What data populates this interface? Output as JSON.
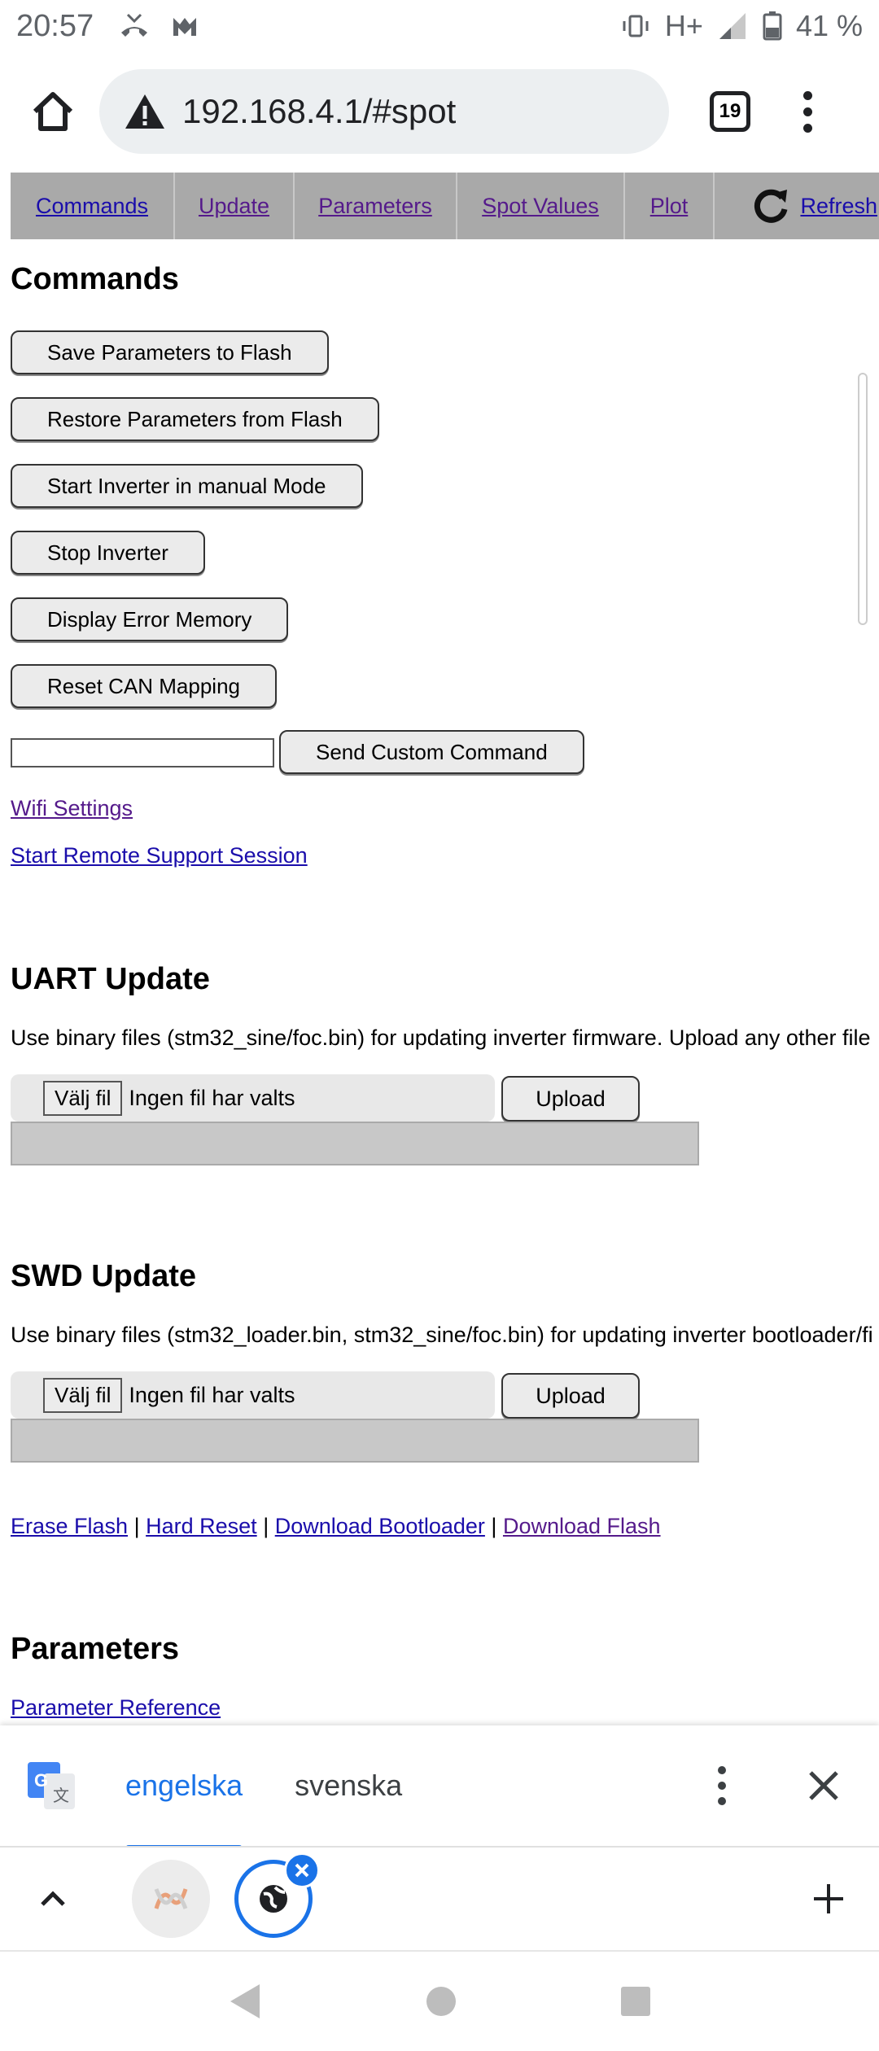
{
  "status_bar": {
    "time": "20:57",
    "network": "H+",
    "battery": "41 %"
  },
  "browser": {
    "url": "192.168.4.1/#spot",
    "tab_count": "19"
  },
  "nav": {
    "items": [
      {
        "label": "Commands"
      },
      {
        "label": "Update"
      },
      {
        "label": "Parameters"
      },
      {
        "label": "Spot Values"
      },
      {
        "label": "Plot"
      },
      {
        "label": "Refresh"
      }
    ]
  },
  "commands": {
    "heading": "Commands",
    "buttons": [
      "Save Parameters to Flash",
      "Restore Parameters from Flash",
      "Start Inverter in manual Mode",
      "Stop Inverter",
      "Display Error Memory",
      "Reset CAN Mapping"
    ],
    "custom_input_value": "",
    "send_custom": "Send Custom Command",
    "wifi_link": "Wifi Settings",
    "remote_link": "Start Remote Support Session"
  },
  "uart": {
    "heading": "UART Update",
    "description": "Use binary files (stm32_sine/foc.bin) for updating inverter firmware. Upload any other file",
    "choose_file": "Välj fil",
    "no_file": "Ingen fil har valts",
    "upload": "Upload"
  },
  "swd": {
    "heading": "SWD Update",
    "description": "Use binary files (stm32_loader.bin, stm32_sine/foc.bin) for updating inverter bootloader/fi",
    "choose_file": "Välj fil",
    "no_file": "Ingen fil har valts",
    "upload": "Upload",
    "links": {
      "erase": "Erase Flash",
      "reset": "Hard Reset",
      "bootloader": "Download Bootloader",
      "flash": "Download Flash",
      "sep": "|"
    }
  },
  "parameters": {
    "heading": "Parameters",
    "reference_link": "Parameter Reference"
  },
  "translate": {
    "lang_active": "engelska",
    "lang_other": "svenska"
  },
  "colors": {
    "link": "#1a0dab",
    "visited": "#551a8b",
    "accent": "#1a73e8",
    "navbar": "#a9a9a9"
  }
}
